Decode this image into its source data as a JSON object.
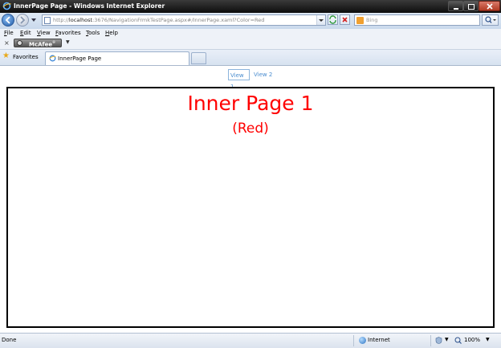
{
  "window": {
    "title": "InnerPage Page - Windows Internet Explorer"
  },
  "address_bar": {
    "url_prefix": "http://",
    "url_host": "localhost",
    "url_rest": ":3676/NavigationFrmkTestPage.aspx#/InnerPage.xaml?Color=Red"
  },
  "search": {
    "placeholder": "Bing"
  },
  "menu": {
    "items": [
      {
        "label": "File"
      },
      {
        "label": "Edit"
      },
      {
        "label": "View"
      },
      {
        "label": "Favorites"
      },
      {
        "label": "Tools"
      },
      {
        "label": "Help"
      }
    ]
  },
  "toolbar": {
    "close_glyph": "×",
    "mcafee_label": "McAfee",
    "mcafee_sup": "®",
    "dropdown_glyph": "▼"
  },
  "favorites_bar": {
    "favorites_label": "Favorites",
    "tab_label": "InnerPage Page"
  },
  "content": {
    "nav_links": [
      {
        "label": "View 1",
        "selected": true
      },
      {
        "label": "View 2",
        "selected": false
      }
    ],
    "heading": "Inner Page 1",
    "subheading": "(Red)",
    "text_color": "#ff0000"
  },
  "status_bar": {
    "status_text": "Done",
    "zone": "Internet",
    "zoom": "100%"
  },
  "colors": {
    "link": "#4a8ccf",
    "title_bar": "#1a1a1a",
    "close_button": "#c0452e"
  }
}
